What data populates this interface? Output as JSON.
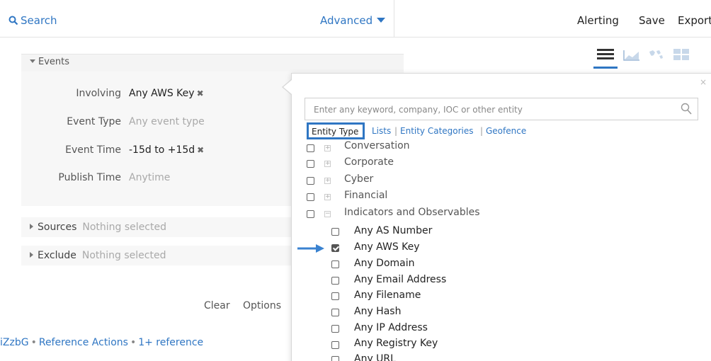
{
  "header": {
    "search_label": "Search",
    "advanced_label": "Advanced",
    "actions": [
      "Alerting",
      "Save",
      "Export"
    ]
  },
  "events": {
    "section_title": "Events",
    "fields": [
      {
        "label": "Involving",
        "value": "Any AWS Key",
        "removable": true
      },
      {
        "label": "Event Type",
        "placeholder": "Any event type"
      },
      {
        "label": "Event Time",
        "value": "-15d to +15d",
        "removable": true
      },
      {
        "label": "Publish Time",
        "placeholder": "Anytime"
      }
    ],
    "remove_glyph": "✖"
  },
  "sources": {
    "label": "Sources",
    "value": "Nothing selected"
  },
  "exclude": {
    "label": "Exclude",
    "value": "Nothing selected"
  },
  "footer": {
    "clear_label": "Clear",
    "options_label": "Options"
  },
  "bottom_links": {
    "id_fragment": "iZzbG",
    "reference_actions": "Reference Actions",
    "reference_count": "1+ reference",
    "sep": "•"
  },
  "view_modes": [
    "list-view-icon",
    "area-chart-icon",
    "map-view-icon",
    "grid-view-icon"
  ],
  "entity_picker": {
    "search_placeholder": "Enter any keyword, company, IOC or other entity",
    "tabs": [
      "Entity Type",
      "Lists",
      "Entity Categories",
      "Geofence"
    ],
    "active_tab": "Entity Type",
    "categories": [
      {
        "label": "Conversation",
        "expanded": false
      },
      {
        "label": "Corporate",
        "expanded": false
      },
      {
        "label": "Cyber",
        "expanded": false
      },
      {
        "label": "Financial",
        "expanded": false
      },
      {
        "label": "Indicators and Observables",
        "expanded": true
      }
    ],
    "items": [
      {
        "label": "Any AS Number",
        "checked": false
      },
      {
        "label": "Any AWS Key",
        "checked": true
      },
      {
        "label": "Any Domain",
        "checked": false
      },
      {
        "label": "Any Email Address",
        "checked": false
      },
      {
        "label": "Any Filename",
        "checked": false
      },
      {
        "label": "Any Hash",
        "checked": false
      },
      {
        "label": "Any IP Address",
        "checked": false
      },
      {
        "label": "Any Registry Key",
        "checked": false
      },
      {
        "label": "Any URL",
        "checked": false
      }
    ],
    "close_glyph": "×"
  },
  "colors": {
    "accent": "#2f76c3",
    "muted": "#a9a9a9",
    "panel_bg": "#f7f7f7"
  }
}
